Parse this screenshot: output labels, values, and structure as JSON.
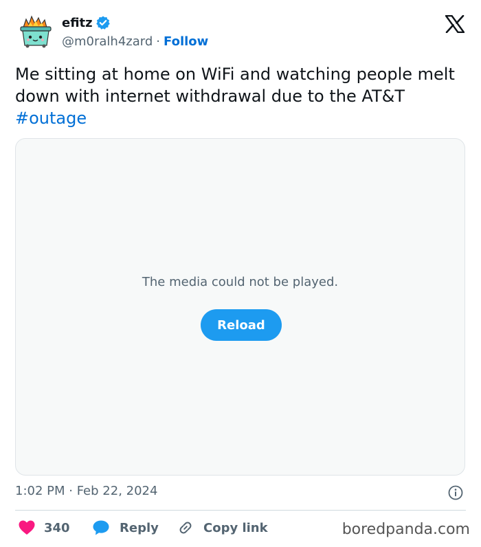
{
  "author": {
    "display_name": "efitz",
    "handle": "@m0ralh4zard",
    "separator": "·",
    "follow_label": "Follow",
    "avatar_icon": "flaming-dumpster-icon",
    "verified_icon": "verified-badge-icon"
  },
  "platform_logo": "x-logo-icon",
  "tweet": {
    "text": "Me sitting at home on WiFi and watching people melt down with internet withdrawal due to the AT&T ",
    "hashtag": "#outage"
  },
  "media": {
    "error_message": "The media could not be played.",
    "reload_label": "Reload"
  },
  "timestamp": "1:02 PM · Feb 22, 2024",
  "info_icon": "info-icon",
  "actions": {
    "like_count": "340",
    "reply_label": "Reply",
    "copy_link_label": "Copy link"
  },
  "watermark": "boredpanda.com",
  "colors": {
    "link": "#006fd6",
    "button": "#1d9bf0",
    "like": "#f91880",
    "muted": "#536471"
  }
}
